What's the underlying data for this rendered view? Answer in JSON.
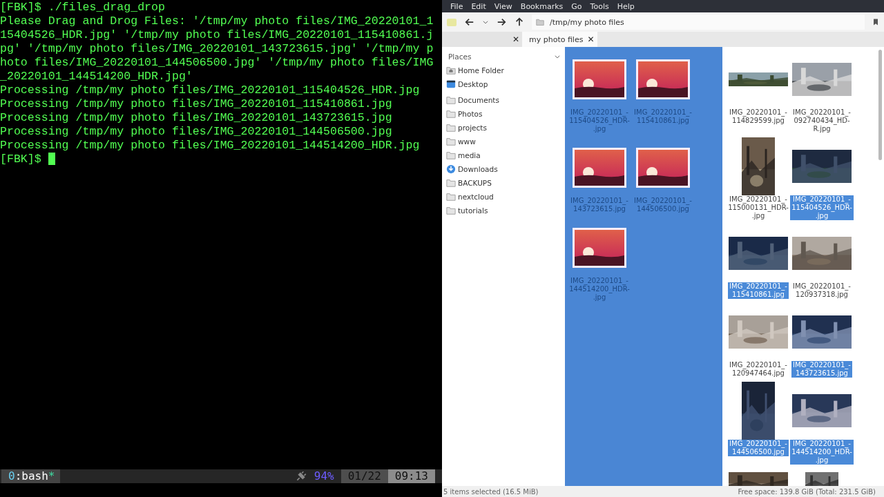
{
  "terminal": {
    "lines": [
      {
        "kind": "command",
        "prompt": "[FBK]$",
        "text": "./files_drag_drop"
      },
      {
        "kind": "output",
        "text": "Please Drag and Drog Files: '/tmp/my photo files/IMG_20220101_115404526_HDR.jpg' '/tmp/my photo files/IMG_20220101_115410861.jpg' '/tmp/my photo files/IMG_20220101_143723615.jpg' '/tmp/my photo files/IMG_20220101_144506500.jpg' '/tmp/my photo files/IMG_20220101_144514200_HDR.jpg'"
      },
      {
        "kind": "output",
        "text": "Processing /tmp/my photo files/IMG_20220101_115404526_HDR.jpg"
      },
      {
        "kind": "output",
        "text": "Processing /tmp/my photo files/IMG_20220101_115410861.jpg"
      },
      {
        "kind": "output",
        "text": "Processing /tmp/my photo files/IMG_20220101_143723615.jpg"
      },
      {
        "kind": "output",
        "text": "Processing /tmp/my photo files/IMG_20220101_144506500.jpg"
      },
      {
        "kind": "output",
        "text": "Processing /tmp/my photo files/IMG_20220101_144514200_HDR.jpg"
      },
      {
        "kind": "prompt",
        "prompt": "[FBK]$"
      }
    ],
    "status_bar": {
      "window_index": "0",
      "window_name": ":bash",
      "window_flag": "*",
      "battery": "94%",
      "date": "01/22",
      "time": "09:13"
    }
  },
  "file_manager": {
    "menu": [
      "File",
      "Edit",
      "View",
      "Bookmarks",
      "Go",
      "Tools",
      "Help"
    ],
    "path": "/tmp/my photo files",
    "tabs": [
      {
        "close": "✕",
        "selected": false
      },
      {
        "label": "my photo files",
        "close": "✕",
        "selected": true
      }
    ],
    "places_title": "Places",
    "places": [
      {
        "kind": "home",
        "label": "Home Folder"
      },
      {
        "kind": "desktop",
        "label": "Desktop"
      },
      {
        "kind": "folder",
        "label": "Documents"
      },
      {
        "kind": "folder",
        "label": "Photos"
      },
      {
        "kind": "folder",
        "label": "projects"
      },
      {
        "kind": "folder",
        "label": "www"
      },
      {
        "kind": "folder",
        "label": "media"
      },
      {
        "kind": "download",
        "label": "Downloads"
      },
      {
        "kind": "folder",
        "label": "BACKUPS"
      },
      {
        "kind": "folder",
        "label": "nextcloud"
      },
      {
        "kind": "folder",
        "label": "tutorials"
      }
    ],
    "dragged": [
      {
        "label": "IMG_20220101_-\n115404526_HDR-\n.jpg"
      },
      {
        "label": "IMG_20220101_-\n115410861.jpg"
      },
      {
        "label": "IMG_20220101_-\n143723615.jpg"
      },
      {
        "label": "IMG_20220101_-\n144506500.jpg"
      },
      {
        "label": "IMG_20220101_-\n144514200_HDR-\n.jpg"
      }
    ],
    "files": [
      {
        "kind": "file",
        "label": "IMG_20220101_-\n114829599.jpg",
        "selected": false
      },
      {
        "kind": "file",
        "label": "IMG_20220101_-\n092740434_HD-\nR.jpg",
        "selected": false
      },
      {
        "kind": "file",
        "label": "IMG_20220101_-\n115000131_HDR-\n.jpg",
        "selected": false
      },
      {
        "kind": "file",
        "label": "IMG_20220101_-\n115404526_HDR-\n.jpg",
        "selected": true
      },
      {
        "kind": "file",
        "label": "IMG_20220101_-\n115410861.jpg",
        "selected": true
      },
      {
        "kind": "file",
        "label": "IMG_20220101_-\n120937318.jpg",
        "selected": false
      },
      {
        "kind": "file",
        "label": "IMG_20220101_-\n120947464.jpg",
        "selected": false
      },
      {
        "kind": "file",
        "label": "IMG_20220101_-\n143723615.jpg",
        "selected": true
      },
      {
        "kind": "file",
        "label": "IMG_20220101_-\n144506500.jpg",
        "selected": true
      },
      {
        "kind": "file",
        "label": "IMG_20220101_-\n144514200_HDR-\n.jpg",
        "selected": true
      },
      {
        "kind": "picture"
      },
      {
        "kind": "picture"
      }
    ],
    "status_left": "5 items selected (16.5 MiB)",
    "status_right": "Free space: 139.8 GiB (Total: 231.5 GiB)"
  }
}
